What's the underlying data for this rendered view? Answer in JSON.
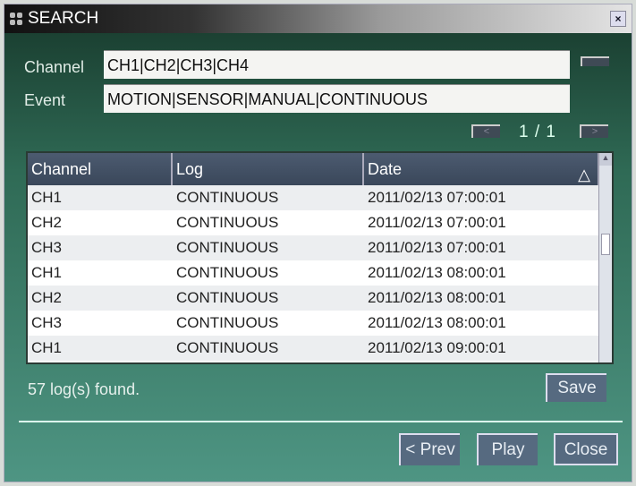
{
  "title": "SEARCH",
  "close_glyph": "×",
  "channel": {
    "label": "Channel",
    "value": "CH1|CH2|CH3|CH4"
  },
  "event": {
    "label": "Event",
    "value": "MOTION|SENSOR|MANUAL|CONTINUOUS"
  },
  "pager": {
    "prev": "<",
    "next": ">",
    "text": "1 / 1"
  },
  "table": {
    "headers": [
      "Channel",
      "Log",
      "Date"
    ],
    "sort_glyph": "△",
    "rows": [
      [
        "CH1",
        "CONTINUOUS",
        "2011/02/13 07:00:01"
      ],
      [
        "CH2",
        "CONTINUOUS",
        "2011/02/13 07:00:01"
      ],
      [
        "CH3",
        "CONTINUOUS",
        "2011/02/13 07:00:01"
      ],
      [
        "CH1",
        "CONTINUOUS",
        "2011/02/13 08:00:01"
      ],
      [
        "CH2",
        "CONTINUOUS",
        "2011/02/13 08:00:01"
      ],
      [
        "CH3",
        "CONTINUOUS",
        "2011/02/13 08:00:01"
      ],
      [
        "CH1",
        "CONTINUOUS",
        "2011/02/13 09:00:01"
      ]
    ]
  },
  "status": "57 log(s) found.",
  "buttons": {
    "save": "Save",
    "prev": "< Prev",
    "play": "Play",
    "close": "Close"
  }
}
